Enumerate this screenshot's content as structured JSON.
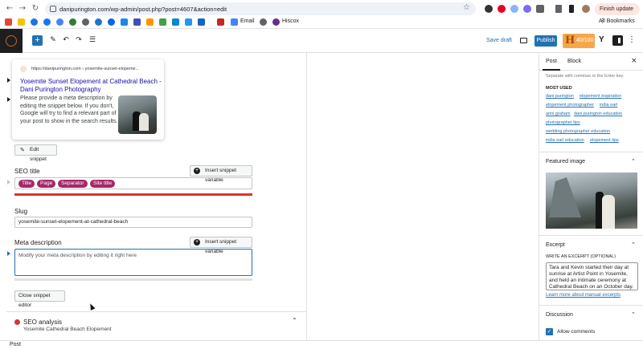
{
  "browser": {
    "url": "danipurington.com/wp-admin/post.php?post=4607&action=edit",
    "finish_update": "Finish update",
    "bookmarks": [
      {
        "label": "Email",
        "color": "#d44638"
      },
      {
        "label": "Hiscox",
        "color": "#6a2c8e"
      }
    ],
    "all_bookmarks": "All Bookmarks"
  },
  "toolbar": {
    "save_draft": "Save draft",
    "publish": "Publish",
    "score_letter": "H",
    "score": "40/100",
    "yoast": "Y"
  },
  "preview": {
    "url": "https://danipurington.com › yosemite-sunset-elopeme...",
    "title": "Yosemite Sunset Elopement at Cathedral Beach - Dani Purington Photography",
    "description": "Please provide a meta description by editing the snippet below. If you don't, Google will try to find a relevant part of your post to show in the search results."
  },
  "edit_snippet": "Edit snippet",
  "seo_title": {
    "label": "SEO title",
    "insert_variable": "Insert snippet variable",
    "tags": [
      "Title",
      "Page",
      "Separator",
      "Site title"
    ]
  },
  "slug": {
    "label": "Slug",
    "value": "yosemite-sunset-elopement-at-cathedral-beach"
  },
  "meta_description": {
    "label": "Meta description",
    "insert_variable": "Insert snippet variable",
    "placeholder": "Modify your meta description by editing it right here"
  },
  "close_snippet": "Close snippet editor",
  "seo_analysis": {
    "label": "SEO analysis",
    "keyphrase": "Yosemite Cathedral Beach Elopement"
  },
  "sidebar": {
    "tabs": [
      "Post",
      "Block"
    ],
    "tags_hint": "Separate with commas or the Enter key.",
    "most_used_label": "MOST USED",
    "most_used": [
      "dani purington",
      "elopement inspiration",
      "elopement photographer",
      "india earl",
      "anni graham",
      "dani purington education",
      "photographer tips",
      "wedding photographer education",
      "india earl education",
      "elopement tips"
    ],
    "featured_image": "Featured image",
    "excerpt": "Excerpt",
    "excerpt_sub": "WRITE AN EXCERPT (OPTIONAL)",
    "excerpt_text": "Tara and Kevin started their day at sunrise at Artist Point in Yosemite, and held an intimate ceremony at Cathedral Beach on an October day.",
    "learn_more": "Learn more about manual excerpts",
    "discussion": "Discussion",
    "allow_comments": "Allow comments"
  },
  "footer": {
    "breadcrumb": "Post"
  }
}
